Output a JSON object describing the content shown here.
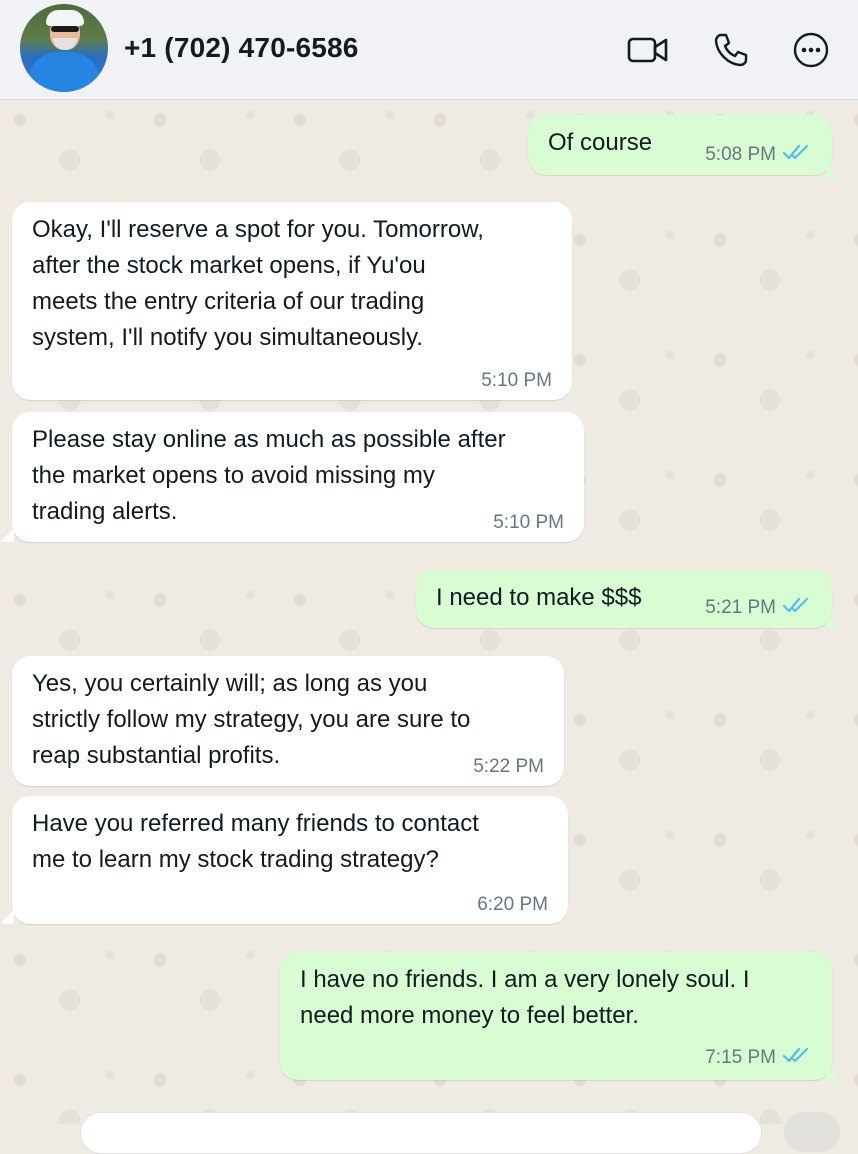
{
  "contact": {
    "name": "+1 (702) 470-6586"
  },
  "header_icons": [
    "video-call-icon",
    "phone-icon",
    "more-options-icon"
  ],
  "colors": {
    "incoming_bubble": "#ffffff",
    "outgoing_bubble": "#d9fdd3",
    "read_ticks": "#53bdeb",
    "chat_background": "#efeae2"
  },
  "messages": [
    {
      "direction": "out",
      "text": "Of course",
      "time": "5:08 PM",
      "read": true
    },
    {
      "direction": "in",
      "text": "Okay, I'll reserve a spot for you. Tomorrow,\nafter the stock market opens, if Yu'ou\nmeets the entry criteria of our trading\nsystem, I'll notify you simultaneously.",
      "time": "5:10 PM"
    },
    {
      "direction": "in",
      "text": "Please stay online as much as possible after\nthe market opens to avoid missing my\ntrading alerts.",
      "time": "5:10 PM"
    },
    {
      "direction": "out",
      "text": "I need to make $$$",
      "time": "5:21 PM",
      "read": true
    },
    {
      "direction": "in",
      "text": "Yes, you certainly will; as long as you\nstrictly follow my strategy, you are sure to\nreap substantial profits.",
      "time": "5:22 PM"
    },
    {
      "direction": "in",
      "text": "Have you referred many friends to contact\nme to learn my stock trading strategy?",
      "time": "6:20 PM"
    },
    {
      "direction": "out",
      "text": "I have no friends. I am a very lonely soul. I\nneed more money to feel better.",
      "time": "7:15 PM",
      "read": true
    }
  ]
}
